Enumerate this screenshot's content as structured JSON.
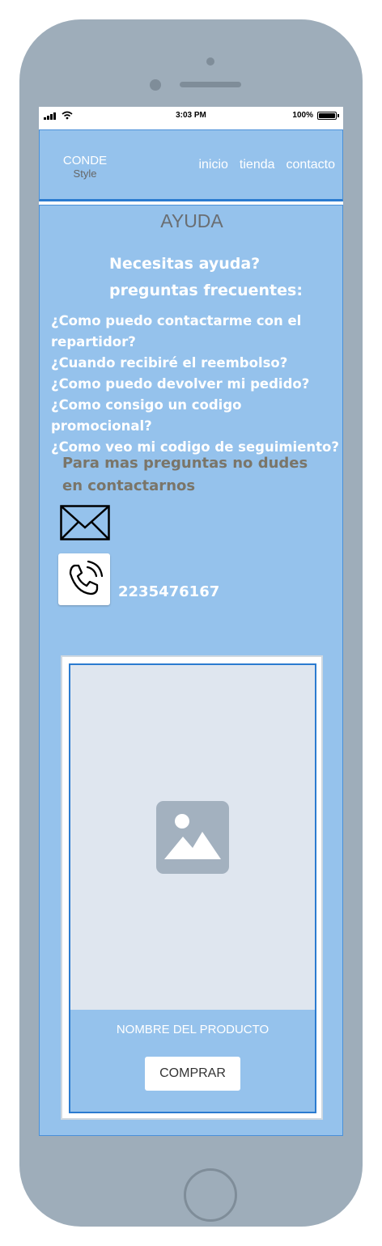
{
  "status_bar": {
    "time": "3:03 PM",
    "battery": "100%"
  },
  "header": {
    "logo_main": "CONDE",
    "logo_sub": "Style",
    "nav": [
      "inicio",
      "tienda",
      "contacto"
    ]
  },
  "page": {
    "title": "AYUDA",
    "help_line1": "Necesitas ayuda?",
    "help_line2": "preguntas frecuentes:",
    "faq": [
      "¿Como puedo contactarme con el repartidor?",
      "¿Cuando recibiré el reembolso?",
      "¿Como puedo devolver mi pedido?",
      "¿Como consigo un codigo promocional?",
      "¿Como veo mi codigo de seguimiento?"
    ],
    "more_questions": "Para mas preguntas no dudes en contactarnos",
    "phone_number": "2235476167"
  },
  "product_card": {
    "name": "NOMBRE DEL PRODUCTO",
    "buy_label": "COMPRAR"
  },
  "icons": {
    "mail": "envelope-icon",
    "phone": "phone-ringing-icon",
    "image": "image-placeholder-icon"
  }
}
